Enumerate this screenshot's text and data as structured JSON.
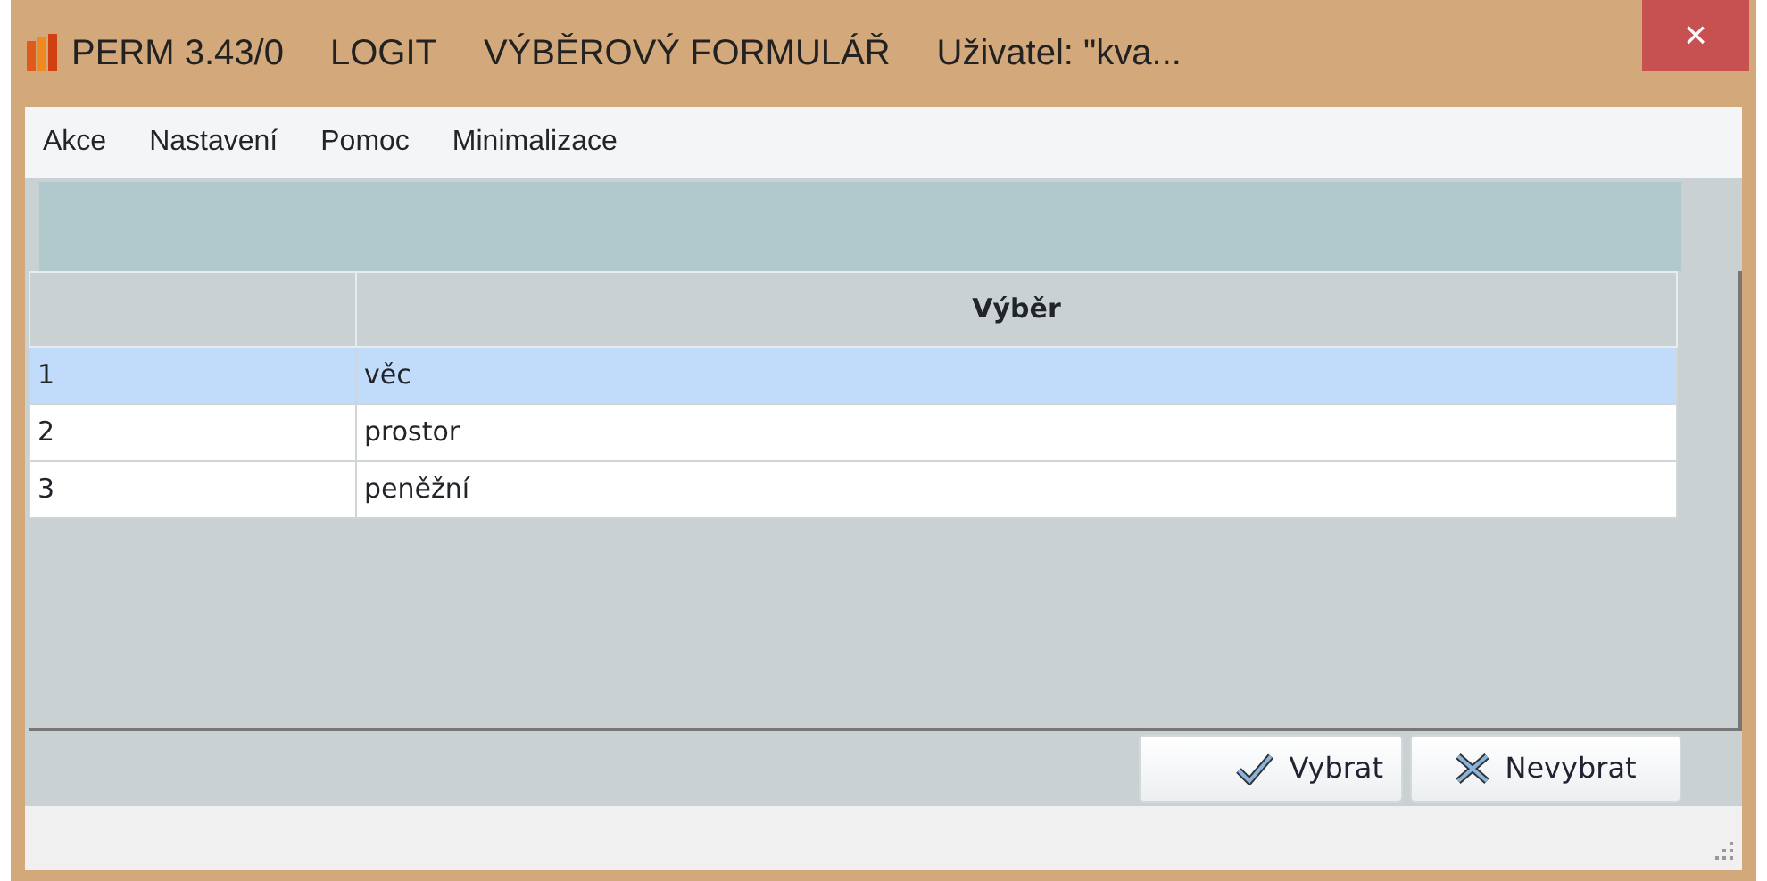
{
  "window": {
    "title_parts": [
      "PERM 3.43/0",
      "LOGIT",
      "VÝBĚROVÝ FORMULÁŘ",
      "Uživatel: \"kva..."
    ],
    "close": "×"
  },
  "menu": [
    "Akce",
    "Nastavení",
    "Pomoc",
    "Minimalizace"
  ],
  "table": {
    "columns": [
      "",
      "Výběr"
    ],
    "rows": [
      {
        "cells": [
          "1",
          "věc"
        ],
        "selected": true
      },
      {
        "cells": [
          "2",
          "prostor"
        ],
        "selected": false
      },
      {
        "cells": [
          "3",
          "peněžní"
        ],
        "selected": false
      }
    ]
  },
  "buttons": [
    {
      "kind": "confirm",
      "label": "Vybrat"
    },
    {
      "kind": "cancel",
      "label": "Nevybrat"
    }
  ]
}
